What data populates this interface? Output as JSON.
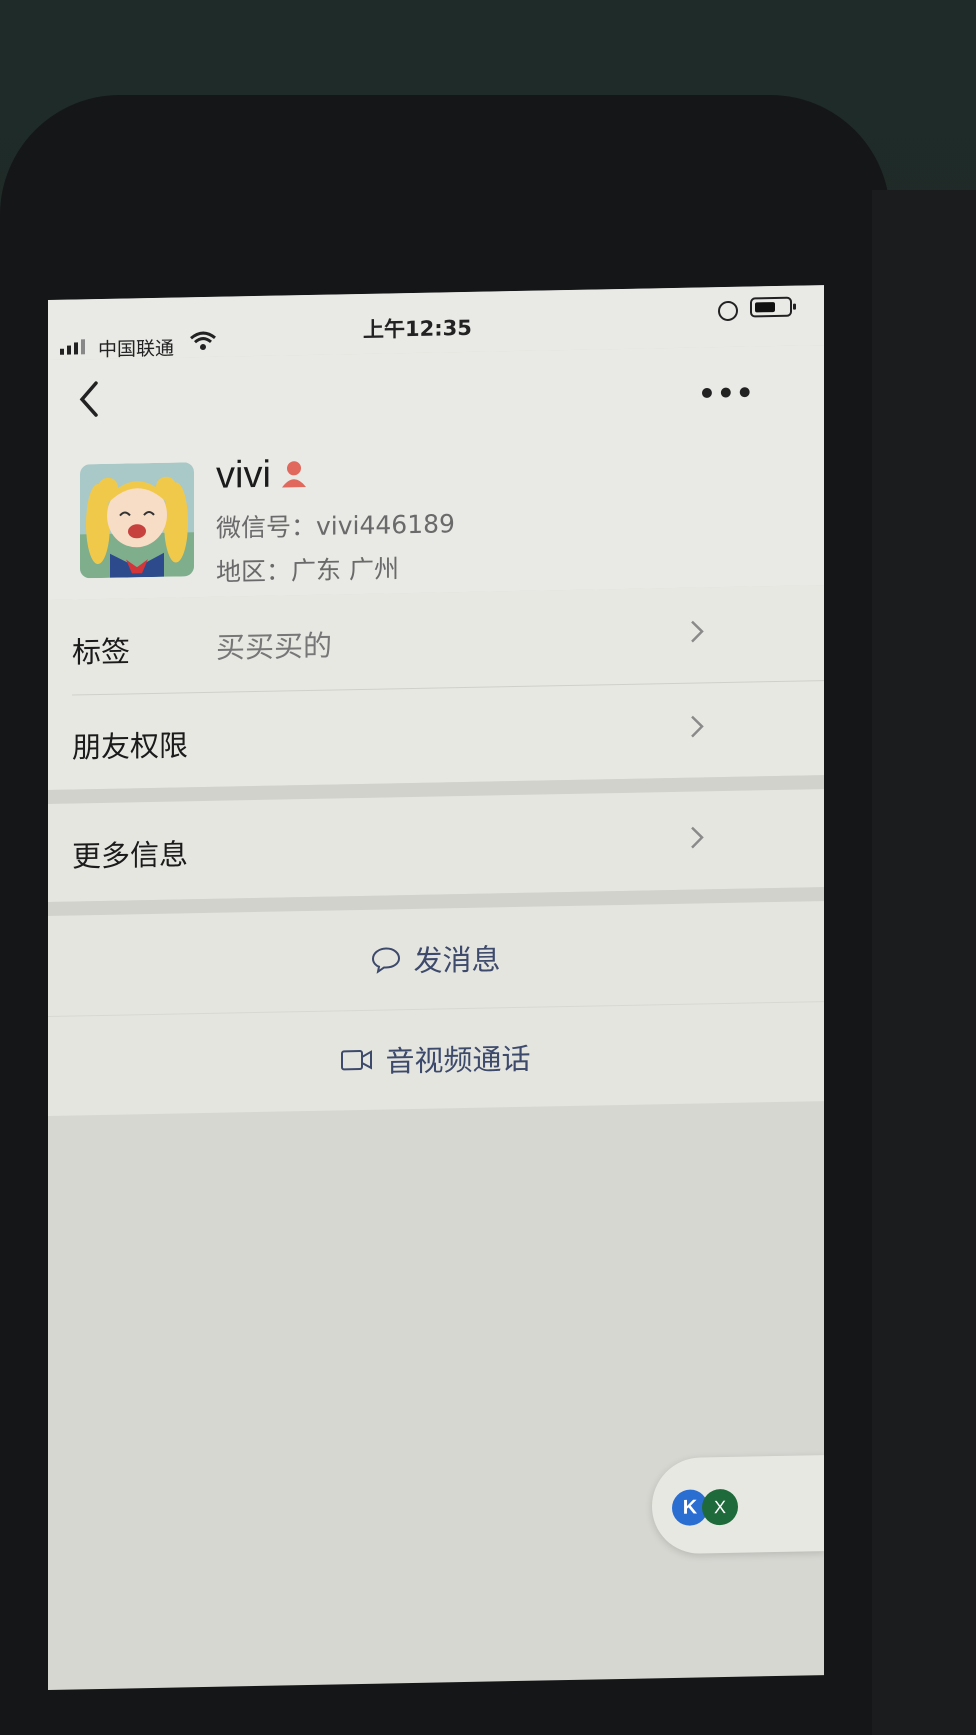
{
  "status_bar": {
    "carrier": "中国联通",
    "time": "上午12:35"
  },
  "profile": {
    "name": "vivi",
    "wechat_id": "微信号：vivi446189",
    "region": "地区：广东 广州"
  },
  "rows": {
    "tag_label": "标签",
    "tag_value": "买买买的",
    "permission_label": "朋友权限",
    "more_info_label": "更多信息"
  },
  "actions": {
    "message_label": "发消息",
    "call_label": "音视频通话"
  },
  "floating_widget": {
    "k_label": "K",
    "x_label": "X"
  },
  "colors": {
    "action_text": "#3d4a6b",
    "user_icon": "#e0685c"
  }
}
